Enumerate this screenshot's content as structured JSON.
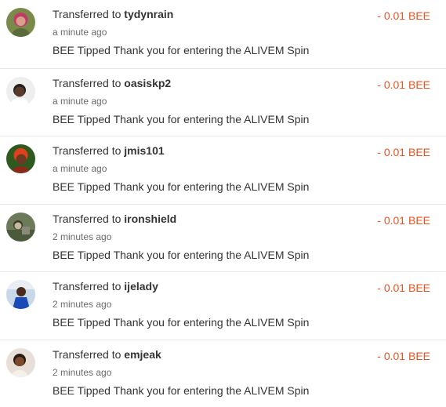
{
  "transfers": [
    {
      "prefix": "Transferred to",
      "user": "tydynrain",
      "time": "a minute ago",
      "memo": "BEE Tipped Thank you for entering the ALIVEM Spin",
      "amount": "- 0.01 BEE",
      "avatar_icon": "user-avatar-icon",
      "avatar_colors": {
        "bg": "#7a8a4a",
        "face": "#d7a08a",
        "hair": "#c03a6a"
      }
    },
    {
      "prefix": "Transferred to",
      "user": "oasiskp2",
      "time": "a minute ago",
      "memo": "BEE Tipped Thank you for entering the ALIVEM Spin",
      "amount": "- 0.01 BEE",
      "avatar_icon": "user-avatar-icon",
      "avatar_colors": {
        "bg": "#eeeeee",
        "face": "#5a3a2a",
        "hair": "#202020"
      }
    },
    {
      "prefix": "Transferred to",
      "user": "jmis101",
      "time": "a minute ago",
      "memo": "BEE Tipped Thank you for entering the ALIVEM Spin",
      "amount": "- 0.01 BEE",
      "avatar_icon": "user-avatar-icon",
      "avatar_colors": {
        "bg": "#2f5a1f",
        "face": "#6b3a22",
        "hair": "#e0401a"
      }
    },
    {
      "prefix": "Transferred to",
      "user": "ironshield",
      "time": "2 minutes ago",
      "memo": "BEE Tipped Thank you for entering the ALIVEM Spin",
      "amount": "- 0.01 BEE",
      "avatar_icon": "user-avatar-icon",
      "avatar_colors": {
        "bg": "#6d7a5a",
        "face": "#c8b8a0",
        "hair": "#3a3a2a"
      }
    },
    {
      "prefix": "Transferred to",
      "user": "ijelady",
      "time": "2 minutes ago",
      "memo": "BEE Tipped Thank you for entering the ALIVEM Spin",
      "amount": "- 0.01 BEE",
      "avatar_icon": "user-avatar-icon",
      "avatar_colors": {
        "bg": "#c8d8e8",
        "face": "#4a2a1a",
        "hair": "#1a4ab8"
      }
    },
    {
      "prefix": "Transferred to",
      "user": "emjeak",
      "time": "2 minutes ago",
      "memo": "BEE Tipped Thank you for entering the ALIVEM Spin",
      "amount": "- 0.01 BEE",
      "avatar_icon": "user-avatar-icon",
      "avatar_colors": {
        "bg": "#e8e0d8",
        "face": "#7a4a2a",
        "hair": "#2a1a10"
      }
    }
  ],
  "colors": {
    "amount": "#e8531f",
    "text": "#333333",
    "muted": "#6b6b6b",
    "divider": "#e6e6e6"
  }
}
